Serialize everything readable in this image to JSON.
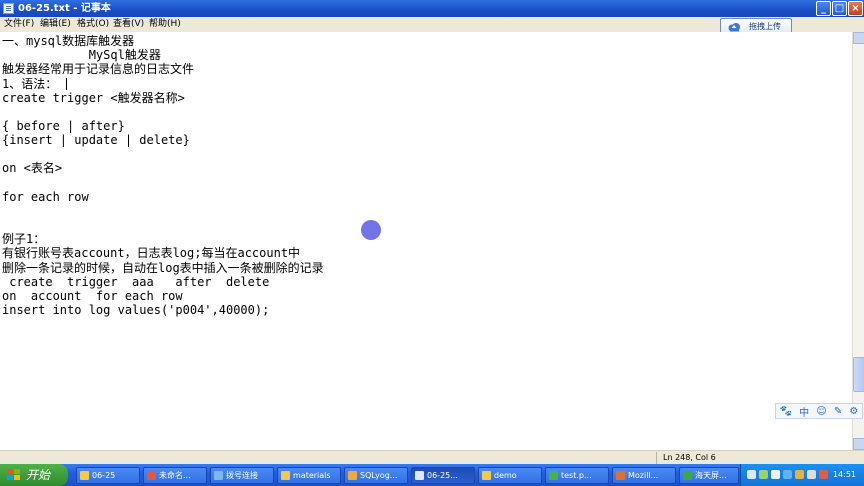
{
  "window": {
    "title": "06-25.txt - 记事本"
  },
  "menu": [
    "文件(F)",
    "编辑(E)",
    "格式(O)",
    "查看(V)",
    "帮助(H)"
  ],
  "upload_button": {
    "label": "拖拽上传"
  },
  "editor": {
    "lines": [
      "一、mysql数据库触发器",
      "            MySql触发器",
      "触发器经常用于记录信息的日志文件",
      "1、语法：",
      "create trigger <触发器名称>",
      "",
      "{ before | after}",
      "{insert | update | delete}",
      "",
      "on <表名>",
      "",
      "for each row",
      "",
      "",
      "例子1：",
      "有银行账号表account，日志表log;每当在account中",
      "删除一条记录的时候，自动在log表中插入一条被删除的记录",
      " create  trigger  aaa   after  delete",
      "on  account  for each row",
      "insert into log values('p004',40000);"
    ]
  },
  "ime_toolbar": {
    "items": [
      "🐾",
      "中",
      "☺",
      "✎",
      "⚙"
    ]
  },
  "status": {
    "position": "Ln 248, Col 6"
  },
  "taskbar": {
    "start_label": "开始",
    "tasks": [
      {
        "label": "06-25",
        "icon_color": "#f2c94c"
      },
      {
        "label": "未命名...",
        "icon_color": "#e05a3a"
      },
      {
        "label": "拨号连接",
        "icon_color": "#7fb8e8"
      },
      {
        "label": "materials",
        "icon_color": "#f2c94c"
      },
      {
        "label": "SQLyog...",
        "icon_color": "#f2a93b"
      },
      {
        "label": "06-25...",
        "icon_color": "#dfe8ff",
        "active": true
      },
      {
        "label": "demo",
        "icon_color": "#f2c94c"
      },
      {
        "label": "test.p...",
        "icon_color": "#4ab04a"
      },
      {
        "label": "Mozill...",
        "icon_color": "#e07030"
      },
      {
        "label": "海天屏...",
        "icon_color": "#3aaa3a"
      }
    ],
    "clock": "14:51"
  }
}
